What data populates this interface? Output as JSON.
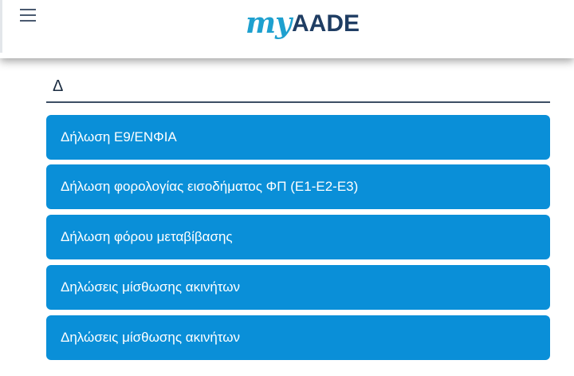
{
  "header": {
    "logo_my": "my",
    "logo_aade": "AADE"
  },
  "section": {
    "letter": "Δ"
  },
  "items": [
    {
      "label": "Δήλωση Ε9/ΕΝΦΙΑ"
    },
    {
      "label": "Δήλωση φορολογίας εισοδήματος ΦΠ (Ε1-Ε2-Ε3)"
    },
    {
      "label": "Δήλωση φόρου μεταβίβασης"
    },
    {
      "label": "Δηλώσεις μίσθωσης ακινήτων"
    },
    {
      "label": "Δηλώσεις μίσθωσης ακινήτων"
    }
  ],
  "colors": {
    "accent": "#0a8fd8",
    "brand_blue": "#1ea0cf",
    "brand_navy": "#1f3d63"
  }
}
